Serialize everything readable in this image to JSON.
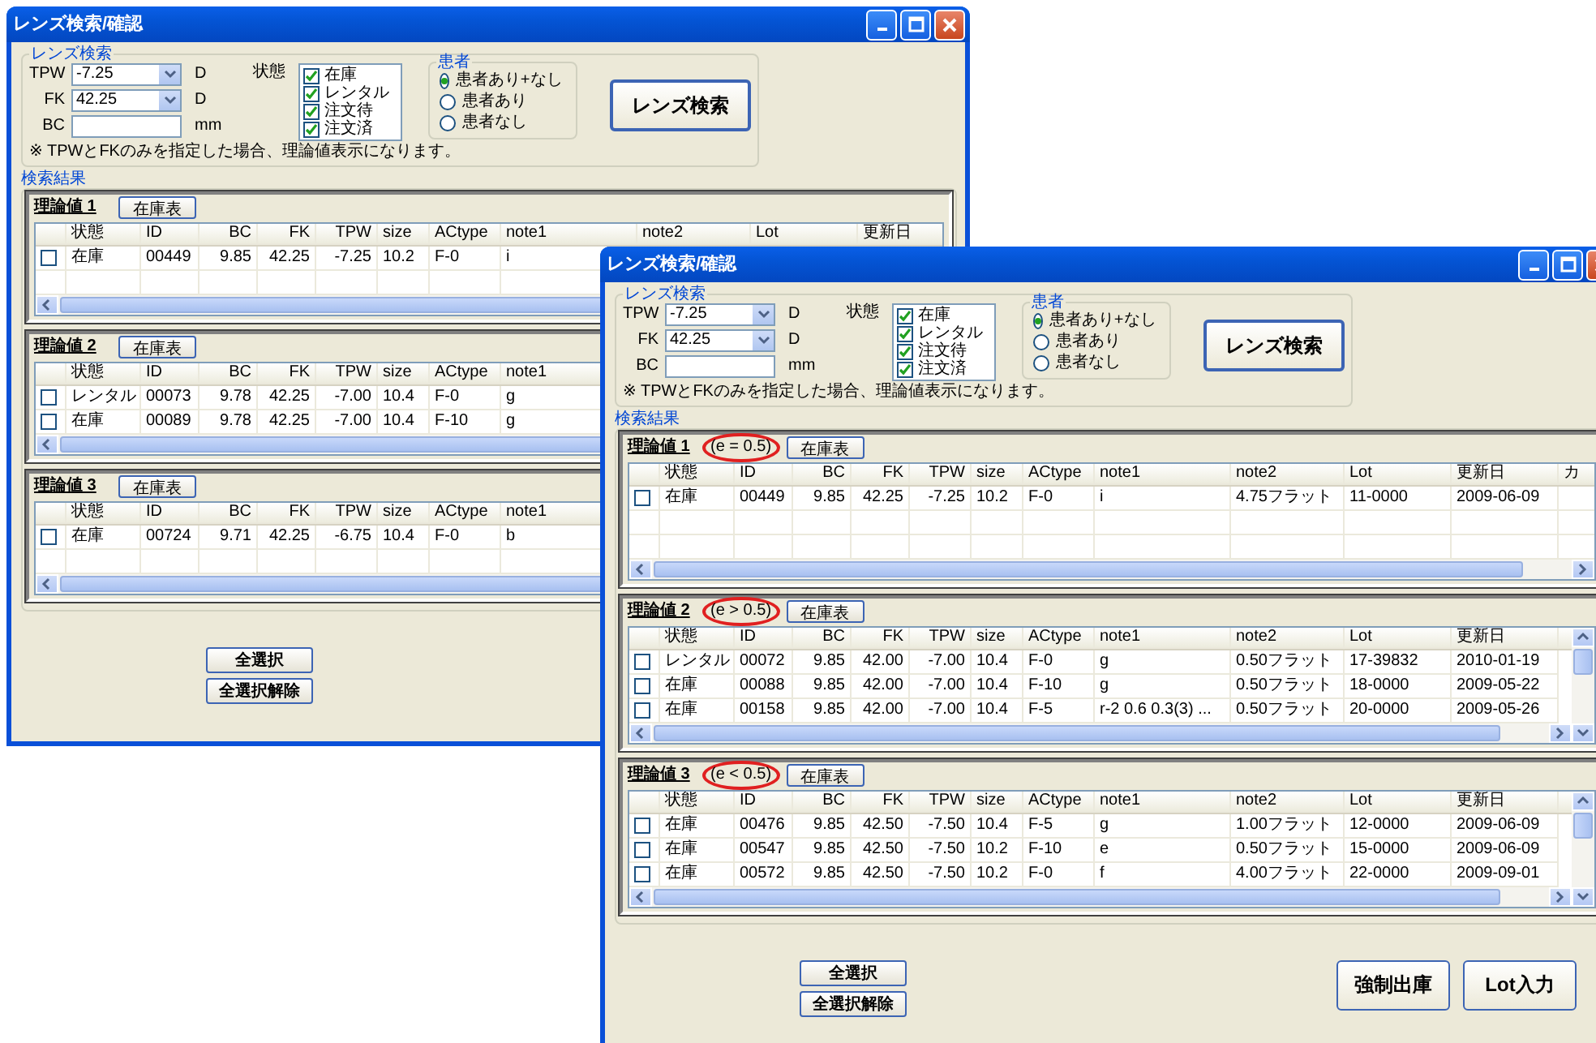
{
  "windows": [
    {
      "title": "レンズ検索/確認",
      "search": {
        "group_label": "レンズ検索",
        "fields": [
          {
            "label": "TPW",
            "value": "-7.25",
            "unit": "D",
            "kind": "combo"
          },
          {
            "label": "FK",
            "value": "42.25",
            "unit": "D",
            "kind": "combo"
          },
          {
            "label": "BC",
            "unit": "mm",
            "kind": "text"
          }
        ],
        "status_label": "状態",
        "statuses": [
          {
            "label": "在庫",
            "checked": true
          },
          {
            "label": "レンタル",
            "checked": true
          },
          {
            "label": "注文待",
            "checked": true
          },
          {
            "label": "注文済",
            "checked": true
          }
        ],
        "patient": {
          "label": "患者",
          "options": [
            {
              "label": "患者あり+なし",
              "selected": true
            },
            {
              "label": "患者あり",
              "selected": false
            },
            {
              "label": "患者なし",
              "selected": false
            }
          ]
        },
        "search_button": "レンズ検索",
        "note": "※ TPWとFKのみを指定した場合、理論値表示になります。"
      },
      "results_label": "検索結果",
      "tables": [
        {
          "title": "理論値 1",
          "stock_button": "在庫表",
          "columns": [
            "状態",
            "ID",
            "BC",
            "FK",
            "TPW",
            "size",
            "ACtype",
            "note1",
            "note2",
            "Lot",
            "更新日"
          ],
          "rows": [
            {
              "checked": false,
              "cells": [
                "在庫",
                "00449",
                "9.85",
                "42.25",
                "-7.25",
                "10.2",
                "F-0",
                "i"
              ]
            }
          ]
        },
        {
          "title": "理論値 2",
          "stock_button": "在庫表",
          "columns": [
            "状態",
            "ID",
            "BC",
            "FK",
            "TPW",
            "size",
            "ACtype",
            "note1"
          ],
          "rows": [
            {
              "checked": false,
              "cells": [
                "レンタル",
                "00073",
                "9.78",
                "42.25",
                "-7.00",
                "10.4",
                "F-0",
                "g"
              ]
            },
            {
              "checked": false,
              "cells": [
                "在庫",
                "00089",
                "9.78",
                "42.25",
                "-7.00",
                "10.4",
                "F-10",
                "g"
              ]
            }
          ]
        },
        {
          "title": "理論値 3",
          "stock_button": "在庫表",
          "columns": [
            "状態",
            "ID",
            "BC",
            "FK",
            "TPW",
            "size",
            "ACtype",
            "note1"
          ],
          "rows": [
            {
              "checked": false,
              "cells": [
                "在庫",
                "00724",
                "9.71",
                "42.25",
                "-6.75",
                "10.4",
                "F-0",
                "b"
              ]
            }
          ]
        }
      ],
      "select_buttons": [
        "全選択",
        "全選択解除"
      ]
    },
    {
      "title": "レンズ検索/確認",
      "search": {
        "group_label": "レンズ検索",
        "fields": [
          {
            "label": "TPW",
            "value": "-7.25",
            "unit": "D",
            "kind": "combo"
          },
          {
            "label": "FK",
            "value": "42.25",
            "unit": "D",
            "kind": "combo"
          },
          {
            "label": "BC",
            "unit": "mm",
            "kind": "text"
          }
        ],
        "status_label": "状態",
        "statuses": [
          {
            "label": "在庫",
            "checked": true
          },
          {
            "label": "レンタル",
            "checked": true
          },
          {
            "label": "注文待",
            "checked": true
          },
          {
            "label": "注文済",
            "checked": true
          }
        ],
        "patient": {
          "label": "患者",
          "options": [
            {
              "label": "患者あり+なし",
              "selected": true
            },
            {
              "label": "患者あり",
              "selected": false
            },
            {
              "label": "患者なし",
              "selected": false
            }
          ]
        },
        "search_button": "レンズ検索",
        "note": "※ TPWとFKのみを指定した場合、理論値表示になります。"
      },
      "results_label": "検索結果",
      "tables": [
        {
          "title": "理論値 1",
          "condition": "(e = 0.5)",
          "stock_button": "在庫表",
          "columns": [
            "状態",
            "ID",
            "BC",
            "FK",
            "TPW",
            "size",
            "ACtype",
            "note1",
            "note2",
            "Lot",
            "更新日",
            "カ"
          ],
          "rows": [
            {
              "checked": false,
              "cells": [
                "在庫",
                "00449",
                "9.85",
                "42.25",
                "-7.25",
                "10.2",
                "F-0",
                "i",
                "4.75フラット",
                "11-0000",
                "2009-06-09"
              ]
            }
          ]
        },
        {
          "title": "理論値 2",
          "condition": "(e > 0.5)",
          "stock_button": "在庫表",
          "columns": [
            "状態",
            "ID",
            "BC",
            "FK",
            "TPW",
            "size",
            "ACtype",
            "note1",
            "note2",
            "Lot",
            "更新日"
          ],
          "rows": [
            {
              "checked": false,
              "cells": [
                "レンタル",
                "00072",
                "9.85",
                "42.00",
                "-7.00",
                "10.4",
                "F-0",
                "g",
                "0.50フラット",
                "17-39832",
                "2010-01-19"
              ]
            },
            {
              "checked": false,
              "cells": [
                "在庫",
                "00088",
                "9.85",
                "42.00",
                "-7.00",
                "10.4",
                "F-10",
                "g",
                "0.50フラット",
                "18-0000",
                "2009-05-22"
              ]
            },
            {
              "checked": false,
              "cells": [
                "在庫",
                "00158",
                "9.85",
                "42.00",
                "-7.00",
                "10.4",
                "F-5",
                "r-2 0.6 0.3(3) ...",
                "0.50フラット",
                "20-0000",
                "2009-05-26"
              ]
            }
          ]
        },
        {
          "title": "理論値 3",
          "condition": "(e < 0.5)",
          "stock_button": "在庫表",
          "columns": [
            "状態",
            "ID",
            "BC",
            "FK",
            "TPW",
            "size",
            "ACtype",
            "note1",
            "note2",
            "Lot",
            "更新日"
          ],
          "rows": [
            {
              "checked": false,
              "cells": [
                "在庫",
                "00476",
                "9.85",
                "42.50",
                "-7.50",
                "10.4",
                "F-5",
                "g",
                "1.00フラット",
                "12-0000",
                "2009-06-09"
              ]
            },
            {
              "checked": false,
              "cells": [
                "在庫",
                "00547",
                "9.85",
                "42.50",
                "-7.50",
                "10.2",
                "F-10",
                "e",
                "0.50フラット",
                "15-0000",
                "2009-06-09"
              ]
            },
            {
              "checked": false,
              "cells": [
                "在庫",
                "00572",
                "9.85",
                "42.50",
                "-7.50",
                "10.2",
                "F-0",
                "f",
                "4.00フラット",
                "22-0000",
                "2009-09-01"
              ]
            }
          ]
        }
      ],
      "select_buttons": [
        "全選択",
        "全選択解除"
      ],
      "actions": [
        "強制出庫",
        "Lot入力"
      ]
    }
  ]
}
